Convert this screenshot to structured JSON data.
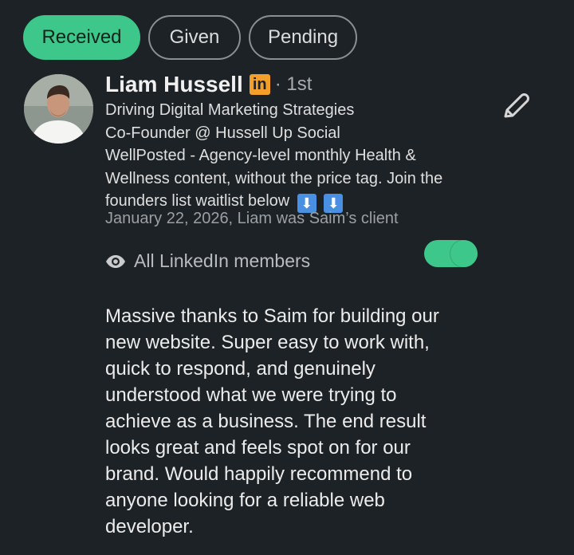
{
  "tabs": [
    {
      "label": "Received",
      "active": true
    },
    {
      "label": "Given",
      "active": false
    },
    {
      "label": "Pending",
      "active": false
    }
  ],
  "recommender": {
    "name": "Liam Hussell",
    "badge": "in",
    "degree": "· 1st",
    "headline": [
      "Driving Digital Marketing Strategies",
      "Co-Founder @ Hussell Up Social",
      "WellPosted - Agency-level monthly Health &",
      "Wellness content, without the price tag. Join the",
      "founders list waitlist below"
    ],
    "headline_emojis": [
      "⬇",
      "⬇"
    ],
    "meta": "January 22, 2026, Liam was Saim’s client"
  },
  "visibility": {
    "label": "All LinkedIn members",
    "enabled": true
  },
  "recommendation_text": "Massive thanks to Saim for building our new website. Super easy to work with, quick to respond, and genuinely understood what we were trying to achieve as a business. The end result looks great and feels spot on for our brand. Would happily recommend to anyone looking for a reliable web developer.",
  "colors": {
    "accent": "#3ec78a",
    "background": "#1d2226",
    "linkedin_badge": "#f2a02a"
  },
  "icons": {
    "edit": "pencil-icon",
    "visibility": "eye-icon"
  }
}
